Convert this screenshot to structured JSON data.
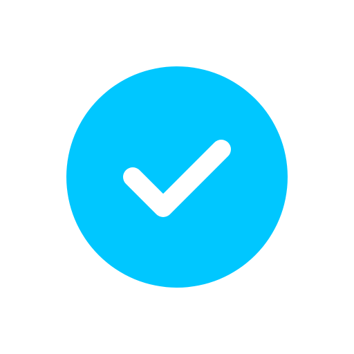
{
  "icon": {
    "name": "check-circle-icon",
    "circle_color": "#00c7ff",
    "check_color": "#ffffff"
  },
  "background_color": "#ffffff"
}
